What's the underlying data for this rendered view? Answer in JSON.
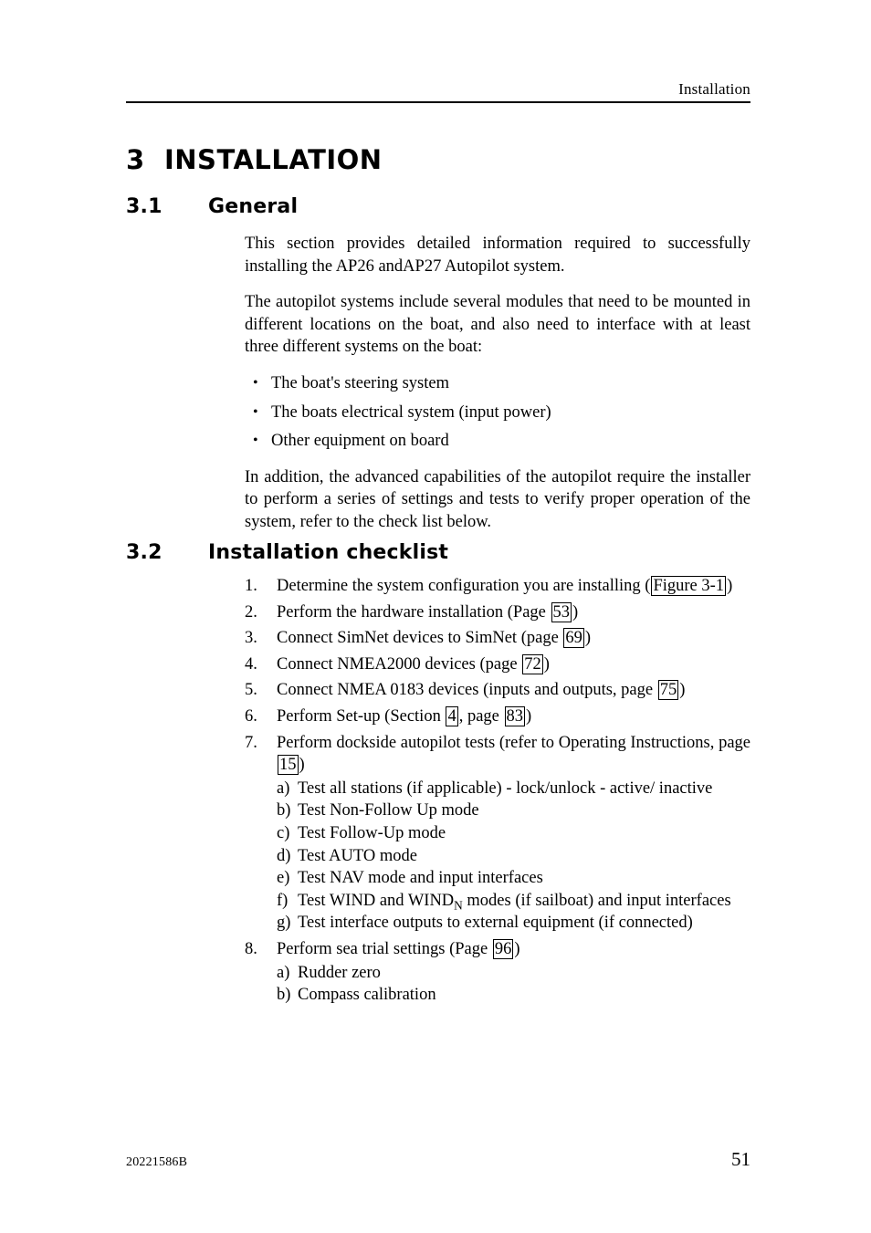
{
  "header": {
    "title": "Installation"
  },
  "headings": {
    "chapter_number": "3",
    "chapter_title": "INSTALLATION",
    "section_1_number": "3.1",
    "section_1_title": "General",
    "section_2_number": "3.2",
    "section_2_title": "Installation checklist"
  },
  "general": {
    "paragraph_1": "This section provides detailed information required to successfully installing the AP26 andAP27 Autopilot system.",
    "paragraph_2": "The autopilot systems include several modules that need to be mounted in different locations on the boat, and also need to interface with at least three different systems on the boat:",
    "bullets": [
      "The boat's steering system",
      "The boats electrical system (input power)",
      "Other equipment on board"
    ],
    "bullet_glyph": "•",
    "paragraph_3": "In addition, the advanced capabilities of the autopilot require the installer to perform a series of settings and tests to verify proper operation of the system, refer to the check list below."
  },
  "checklist": {
    "items": [
      {
        "number": "1.",
        "text_before": "Determine the system configuration you are installing (",
        "xref": "Figure 3-1",
        "text_after": ")"
      },
      {
        "number": "2.",
        "text_before": "Perform the hardware installation (Page ",
        "xref": "53",
        "text_after": ")"
      },
      {
        "number": "3.",
        "text_before": "Connect SimNet devices to SimNet (page ",
        "xref": "69",
        "text_after": ")"
      },
      {
        "number": "4.",
        "text_before": "Connect NMEA2000 devices (page ",
        "xref": "72",
        "text_after": ")"
      },
      {
        "number": "5.",
        "text_before": "Connect NMEA 0183 devices (inputs and outputs, page ",
        "xref": "75",
        "text_after": ")"
      },
      {
        "number": "6.",
        "text_before": "Perform Set-up (Section ",
        "xref": "4",
        "text_middle": ", page ",
        "xref2": "83",
        "text_after": ")"
      },
      {
        "number": "7.",
        "text_before": "Perform dockside autopilot tests (refer to Operating Instructions, page ",
        "xref": "15",
        "text_after": ")",
        "sub_items": [
          {
            "number": "a)",
            "text": "Test all stations (if applicable) - lock/unlock - active/ inactive",
            "justify": true
          },
          {
            "number": "b)",
            "text": "Test Non-Follow Up mode",
            "justify": false
          },
          {
            "number": "c)",
            "text": "Test Follow-Up mode",
            "justify": false
          },
          {
            "number": "d)",
            "text": "Test AUTO mode",
            "justify": false
          },
          {
            "number": "e)",
            "text": "Test NAV mode and input interfaces",
            "justify": false
          },
          {
            "number": "f)",
            "text_part_1": "Test WIND and WIND",
            "subscript": "N",
            "text_part_2": " modes (if sailboat) and input interfaces",
            "justify": true
          },
          {
            "number": "g)",
            "text": "Test interface outputs to external equipment (if connected)",
            "justify": true
          }
        ]
      },
      {
        "number": "8.",
        "text_before": "Perform sea trial settings (Page ",
        "xref": "96",
        "text_after": ")",
        "sub_items": [
          {
            "number": "a)",
            "text": "Rudder zero",
            "justify": false
          },
          {
            "number": "b)",
            "text": "Compass calibration",
            "justify": false
          }
        ]
      }
    ]
  },
  "footer": {
    "document_number": "20221586B",
    "page_number": "51"
  }
}
